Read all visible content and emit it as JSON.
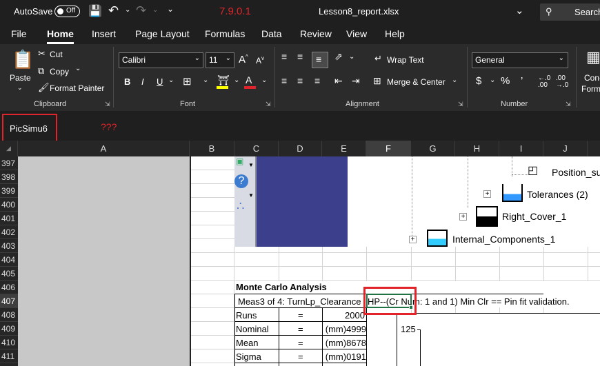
{
  "titlebar": {
    "autosave_label": "AutoSave",
    "autosave_state": "Off",
    "version_text": "7.9.0.1",
    "filename": "Lesson8_report.xlsx",
    "search_placeholder": "Search"
  },
  "tabs": [
    "File",
    "Home",
    "Insert",
    "Page Layout",
    "Formulas",
    "Data",
    "Review",
    "View",
    "Help"
  ],
  "ribbon": {
    "clipboard": {
      "paste": "Paste",
      "cut": "Cut",
      "copy": "Copy",
      "format_painter": "Format Painter",
      "group": "Clipboard"
    },
    "font": {
      "name": "Calibri",
      "size": "11",
      "group": "Font"
    },
    "alignment": {
      "wrap": "Wrap Text",
      "merge": "Merge & Center",
      "group": "Alignment"
    },
    "number": {
      "format": "General",
      "group": "Number"
    },
    "cond_format": "Con-",
    "cond_format2": "Form"
  },
  "formula_bar": {
    "name_box": "PicSimu6",
    "annotation": "???"
  },
  "columns": [
    "A",
    "B",
    "C",
    "D",
    "E",
    "F",
    "G",
    "H",
    "I",
    "J"
  ],
  "selected_column": "F",
  "rows": [
    "397",
    "398",
    "399",
    "400",
    "401",
    "402",
    "403",
    "404",
    "405",
    "406",
    "407",
    "408",
    "409",
    "410",
    "411"
  ],
  "selected_row": "407",
  "tree": {
    "position": "Position_su",
    "tolerances": "Tolerances (2)",
    "right_cover": "Right_Cover_1",
    "internal": "Internal_Components_1"
  },
  "analysis": {
    "title": "Monte Carlo Analysis",
    "meas": "Meas3 of 4: TurnLp_Clearance",
    "desc": "HP--(Cr Num: 1 and 1) Min Clr == Pin fit validation.",
    "labels": [
      "Runs",
      "Nominal",
      "Mean",
      "Sigma"
    ],
    "eq": "=",
    "values": [
      "2000",
      "4999(mm)",
      "8678(mm)",
      "0191(mm)"
    ],
    "chart_tick": "125"
  },
  "colors": {
    "highlight": "#e0242a",
    "dark_bg": "#1f1f1f",
    "ribbon_bg": "#2b2b2b",
    "picture_blue": "#3c3f8c"
  }
}
